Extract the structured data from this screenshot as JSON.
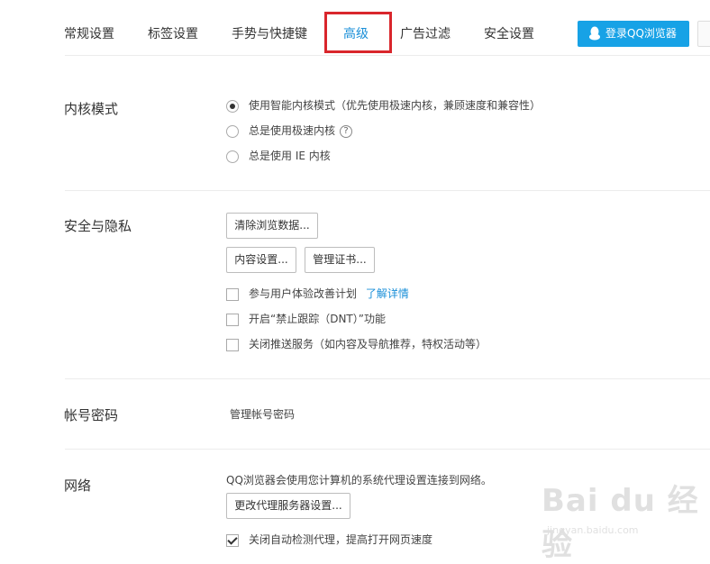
{
  "tabs": [
    {
      "label": "常规设置"
    },
    {
      "label": "标签设置"
    },
    {
      "label": "手势与快捷键"
    },
    {
      "label": "高级"
    },
    {
      "label": "广告过滤"
    },
    {
      "label": "安全设置"
    }
  ],
  "active_tab": "高级",
  "login_button": "登录QQ浏览器",
  "accent_color": "#1a8fd8",
  "highlight_color": "#d9262c",
  "kernel": {
    "title": "内核模式",
    "options": [
      {
        "label": "使用智能内核模式（优先使用极速内核，兼顾速度和兼容性）",
        "selected": true
      },
      {
        "label": "总是使用极速内核",
        "selected": false,
        "help": "?"
      },
      {
        "label": "总是使用 IE 内核",
        "selected": false
      }
    ]
  },
  "privacy": {
    "title": "安全与隐私",
    "clear_data_button": "清除浏览数据...",
    "content_settings_button": "内容设置...",
    "manage_cert_button": "管理证书...",
    "checkboxes": [
      {
        "label": "参与用户体验改善计划",
        "link": "了解详情",
        "checked": false
      },
      {
        "label": "开启“禁止跟踪（DNT）”功能",
        "checked": false
      },
      {
        "label": "关闭推送服务（如内容及导航推荐，特权活动等）",
        "checked": false
      }
    ]
  },
  "account": {
    "title": "帐号密码",
    "manage_link": "管理帐号密码"
  },
  "network": {
    "title": "网络",
    "description": "QQ浏览器会使用您计算机的系统代理设置连接到网络。",
    "proxy_button": "更改代理服务器设置...",
    "auto_detect": {
      "label": "关闭自动检测代理，提高打开网页速度",
      "checked": true
    }
  },
  "watermark": {
    "main": "Bai du 经验",
    "sub": "jingyan.baidu.com"
  }
}
